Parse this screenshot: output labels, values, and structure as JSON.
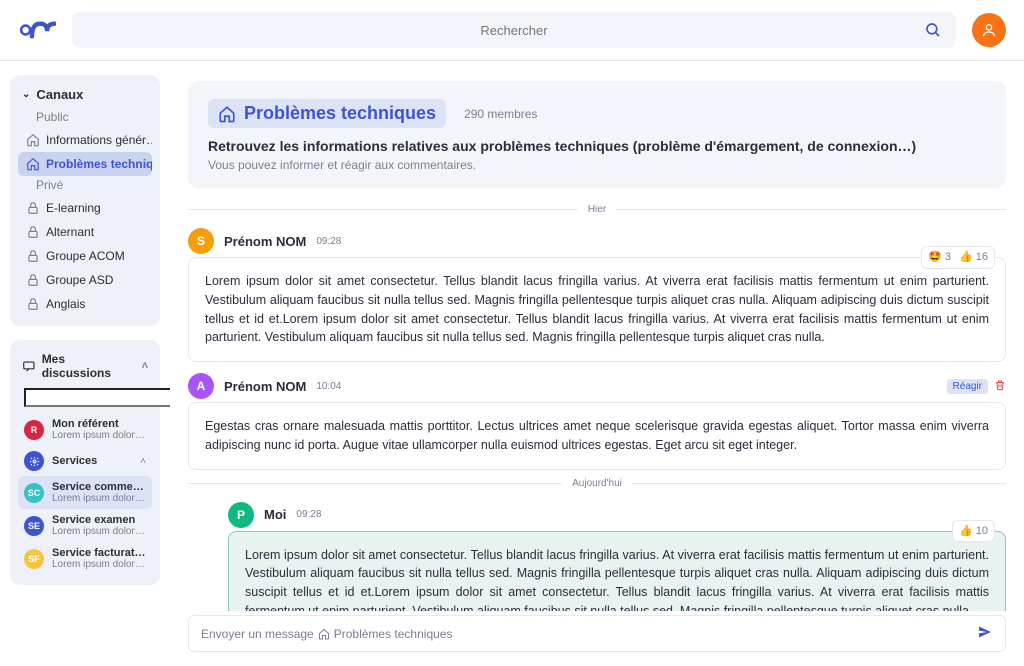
{
  "search": {
    "placeholder": "Rechercher"
  },
  "sidebar": {
    "canaux": {
      "title": "Canaux",
      "public": "Public",
      "items": [
        "Informations génér…",
        "Problèmes techniqu…"
      ],
      "private": "Privé",
      "private_items": [
        "E-learning",
        "Alternant",
        "Groupe ACOM",
        "Groupe ASD",
        "Anglais"
      ]
    },
    "discussions": {
      "title": "Mes discussions",
      "search_placeholder": "",
      "items": [
        {
          "avatar": "R",
          "color": "#d7263d",
          "title": "Mon référent",
          "sub": "Lorem ipsum dolor sit…"
        },
        {
          "avatar": "",
          "color": "#3d55cc",
          "title": "Services",
          "sub": "",
          "expandable": true
        },
        {
          "avatar": "SC",
          "color": "#36c2c2",
          "title": "Service commercial",
          "sub": "Lorem ipsum dolor sit…",
          "highlight": true
        },
        {
          "avatar": "SE",
          "color": "#3d55cc",
          "title": "Service examen",
          "sub": "Lorem ipsum dolor sit…"
        },
        {
          "avatar": "SF",
          "color": "#f5c542",
          "title": "Service facturation",
          "sub": "Lorem ipsum dolor sit…"
        }
      ]
    }
  },
  "channel": {
    "name": "Problèmes techniques",
    "members": "290 membres",
    "headline": "Retrouvez les informations relatives aux problèmes techniques (problème d'émargement, de connexion…)",
    "description": "Vous pouvez informer et réagir aux commentaires."
  },
  "dividers": {
    "yesterday": "Hier",
    "today": "Aujourd'hui"
  },
  "messages": [
    {
      "avatar": "S",
      "avatar_color": "#f59e0b",
      "author": "Prénom NOM",
      "time": "09:28",
      "body": "Lorem ipsum dolor sit amet consectetur. Tellus blandit lacus fringilla varius. At viverra erat facilisis mattis fermentum ut enim parturient. Vestibulum aliquam faucibus sit nulla tellus sed. Magnis fringilla pellentesque turpis aliquet cras nulla. Aliquam adipiscing duis dictum suscipit tellus et id et.Lorem ipsum dolor sit amet consectetur. Tellus blandit lacus fringilla varius. At viverra erat facilisis mattis fermentum ut enim parturient. Vestibulum aliquam faucibus sit nulla tellus sed. Magnis fringilla pellentesque turpis aliquet cras nulla.",
      "reactions": [
        {
          "emoji": "🤩",
          "count": "3"
        },
        {
          "emoji": "👍",
          "count": "16"
        }
      ]
    },
    {
      "avatar": "A",
      "avatar_color": "#a855f7",
      "author": "Prénom NOM",
      "time": "10:04",
      "body": "Egestas cras ornare malesuada mattis porttitor. Lectus ultrices amet neque scelerisque gravida egestas aliquet. Tortor massa enim viverra adipiscing nunc id porta. Augue vitae ullamcorper nulla euismod ultrices egestas. Eget arcu sit eget integer.",
      "react_label": "Réagir"
    },
    {
      "avatar": "P",
      "avatar_color": "#10b981",
      "author": "Moi",
      "time": "09:28",
      "body": "Lorem ipsum dolor sit amet consectetur. Tellus blandit lacus fringilla varius. At viverra erat facilisis mattis fermentum ut enim parturient. Vestibulum aliquam faucibus sit nulla tellus sed. Magnis fringilla pellentesque turpis aliquet cras nulla. Aliquam adipiscing duis dictum suscipit tellus et id et.Lorem ipsum dolor sit amet consectetur. Tellus blandit lacus fringilla varius. At viverra erat facilisis mattis fermentum ut enim parturient. Vestibulum aliquam faucibus sit nulla tellus sed. Magnis fringilla pellentesque turpis aliquet cras nulla.",
      "own": true,
      "reactions": [
        {
          "emoji": "👍",
          "count": "10"
        }
      ]
    }
  ],
  "composer": {
    "prefix": "Envoyer un message",
    "channel": "Problèmes techniques"
  }
}
